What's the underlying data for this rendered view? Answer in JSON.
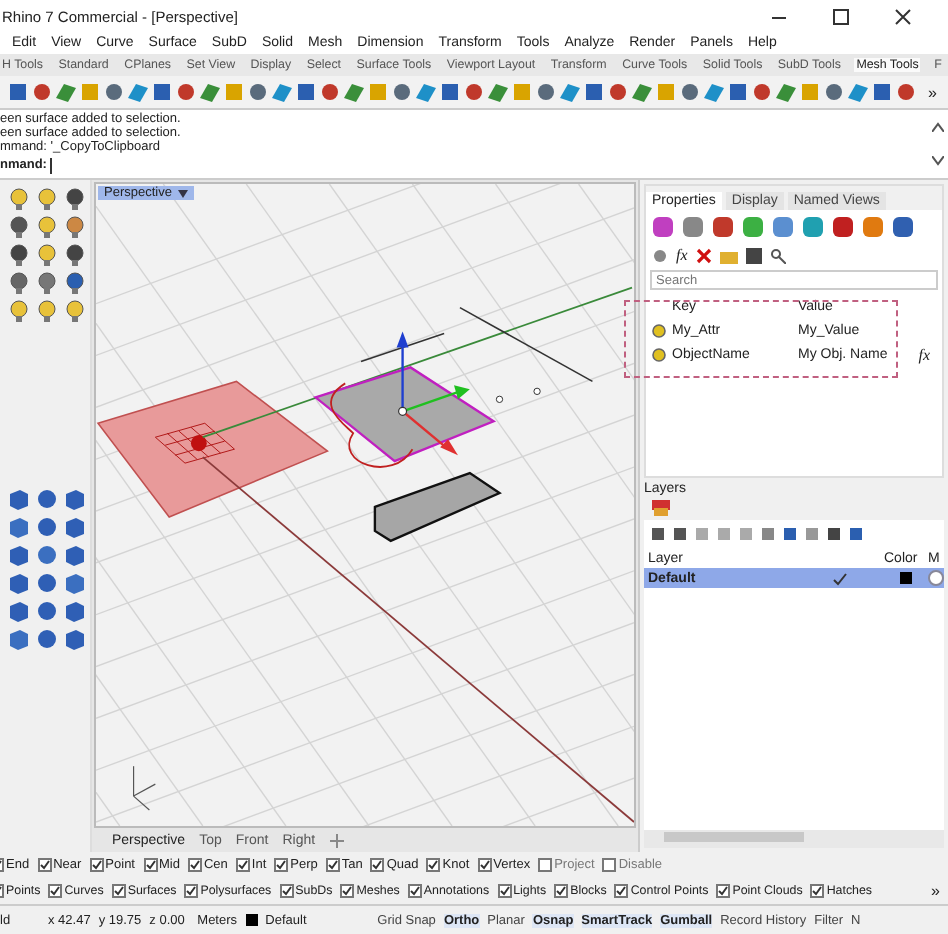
{
  "window": {
    "title": "Rhino 7 Commercial - [Perspective]"
  },
  "menu": [
    "Edit",
    "View",
    "Curve",
    "Surface",
    "SubD",
    "Solid",
    "Mesh",
    "Dimension",
    "Transform",
    "Tools",
    "Analyze",
    "Render",
    "Panels",
    "Help"
  ],
  "toolbar_tabs": [
    {
      "label": "H Tools",
      "selected": false
    },
    {
      "label": "Standard",
      "selected": false
    },
    {
      "label": "CPlanes",
      "selected": false
    },
    {
      "label": "Set View",
      "selected": false
    },
    {
      "label": "Display",
      "selected": false
    },
    {
      "label": "Select",
      "selected": false
    },
    {
      "label": "Surface Tools",
      "selected": false
    },
    {
      "label": "Viewport Layout",
      "selected": false
    },
    {
      "label": "Transform",
      "selected": false
    },
    {
      "label": "Curve Tools",
      "selected": false
    },
    {
      "label": "Solid Tools",
      "selected": false
    },
    {
      "label": "SubD Tools",
      "selected": false
    },
    {
      "label": "Mesh Tools",
      "selected": true
    },
    {
      "label": "F",
      "selected": false
    }
  ],
  "toolbar_overflow": "»",
  "command_history": [
    "een surface added to selection.",
    "een surface added to selection.",
    "mmand: '_CopyToClipboard"
  ],
  "command_prompt": {
    "label": "nmand:"
  },
  "viewport": {
    "label": "Perspective",
    "tabs": [
      {
        "label": "Perspective",
        "selected": true
      },
      {
        "label": "Top",
        "selected": false
      },
      {
        "label": "Front",
        "selected": false
      },
      {
        "label": "Right",
        "selected": false
      }
    ]
  },
  "properties_panel": {
    "tabs": [
      {
        "label": "Properties",
        "selected": true
      },
      {
        "label": "Display",
        "selected": false
      },
      {
        "label": "Named Views",
        "selected": false
      }
    ],
    "toolbar_fx": "fx",
    "search": {
      "placeholder": "Search"
    },
    "columns": [
      "Key",
      "Value"
    ],
    "rows": [
      {
        "key": "My_Attr",
        "value": "My_Value"
      },
      {
        "key": "ObjectName",
        "value": "My Obj. Name"
      }
    ],
    "row_fx": "fx"
  },
  "layers_panel": {
    "title": "Layers",
    "columns": [
      "Layer",
      "Color",
      "M"
    ],
    "rows": [
      {
        "name": "Default",
        "selected": true,
        "current": true,
        "color": "#000000"
      }
    ]
  },
  "osnap": [
    {
      "label": "End",
      "checked": true
    },
    {
      "label": "Near",
      "checked": true
    },
    {
      "label": "Point",
      "checked": true
    },
    {
      "label": "Mid",
      "checked": true
    },
    {
      "label": "Cen",
      "checked": true
    },
    {
      "label": "Int",
      "checked": true
    },
    {
      "label": "Perp",
      "checked": true
    },
    {
      "label": "Tan",
      "checked": true
    },
    {
      "label": "Quad",
      "checked": true
    },
    {
      "label": "Knot",
      "checked": true
    },
    {
      "label": "Vertex",
      "checked": true
    },
    {
      "label": "Project",
      "checked": false
    },
    {
      "label": "Disable",
      "checked": false
    }
  ],
  "filter": [
    {
      "label": "Points",
      "checked": true
    },
    {
      "label": "Curves",
      "checked": true
    },
    {
      "label": "Surfaces",
      "checked": true
    },
    {
      "label": "Polysurfaces",
      "checked": true
    },
    {
      "label": "SubDs",
      "checked": true
    },
    {
      "label": "Meshes",
      "checked": true
    },
    {
      "label": "Annotations",
      "checked": true
    },
    {
      "label": "Lights",
      "checked": true
    },
    {
      "label": "Blocks",
      "checked": true
    },
    {
      "label": "Control Points",
      "checked": true
    },
    {
      "label": "Point Clouds",
      "checked": true
    },
    {
      "label": "Hatches",
      "checked": true
    }
  ],
  "filter_overflow": "»",
  "status_bar": {
    "cells": [
      "ld",
      "x 42.47",
      "y 19.75",
      "z 0.00",
      "Meters"
    ],
    "layer": {
      "label": "Default",
      "color": "#000000"
    },
    "toggles": [
      {
        "label": "Grid Snap",
        "on": false
      },
      {
        "label": "Ortho",
        "on": true
      },
      {
        "label": "Planar",
        "on": false
      },
      {
        "label": "Osnap",
        "on": true
      },
      {
        "label": "SmartTrack",
        "on": true
      },
      {
        "label": "Gumball",
        "on": true
      },
      {
        "label": "Record History",
        "on": false
      },
      {
        "label": "Filter",
        "on": false
      },
      {
        "label": "N",
        "on": false
      }
    ]
  }
}
